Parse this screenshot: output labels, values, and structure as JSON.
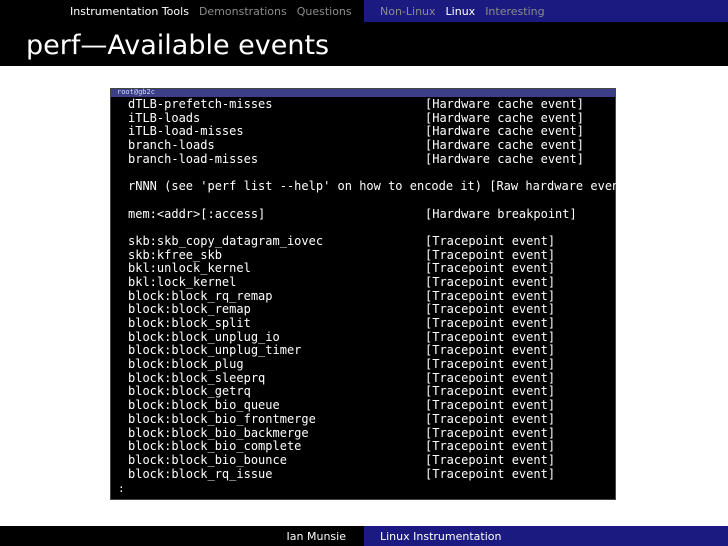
{
  "nav": {
    "sections": [
      "Instrumentation Tools",
      "Demonstrations",
      "Questions"
    ],
    "subsections": [
      "Non-Linux",
      "Linux",
      "Interesting"
    ],
    "active_section": "Instrumentation Tools",
    "active_subsection": "Linux"
  },
  "frame_title": "perf—Available events",
  "terminal": {
    "window_title": "root@gb2c",
    "rows": [
      {
        "event": "dTLB-prefetch-misses",
        "type": "[Hardware cache event]"
      },
      {
        "event": "iTLB-loads",
        "type": "[Hardware cache event]"
      },
      {
        "event": "iTLB-load-misses",
        "type": "[Hardware cache event]"
      },
      {
        "event": "branch-loads",
        "type": "[Hardware cache event]"
      },
      {
        "event": "branch-load-misses",
        "type": "[Hardware cache event]"
      },
      {
        "event": "",
        "type": ""
      },
      {
        "full": "rNNN (see 'perf list --help' on how to encode it) [Raw hardware event"
      },
      {
        "event": "",
        "type": ""
      },
      {
        "event": "mem:<addr>[:access]",
        "type": "[Hardware breakpoint]"
      },
      {
        "event": "",
        "type": ""
      },
      {
        "event": "skb:skb_copy_datagram_iovec",
        "type": "[Tracepoint event]"
      },
      {
        "event": "skb:kfree_skb",
        "type": "[Tracepoint event]"
      },
      {
        "event": "bkl:unlock_kernel",
        "type": "[Tracepoint event]"
      },
      {
        "event": "bkl:lock_kernel",
        "type": "[Tracepoint event]"
      },
      {
        "event": "block:block_rq_remap",
        "type": "[Tracepoint event]"
      },
      {
        "event": "block:block_remap",
        "type": "[Tracepoint event]"
      },
      {
        "event": "block:block_split",
        "type": "[Tracepoint event]"
      },
      {
        "event": "block:block_unplug_io",
        "type": "[Tracepoint event]"
      },
      {
        "event": "block:block_unplug_timer",
        "type": "[Tracepoint event]"
      },
      {
        "event": "block:block_plug",
        "type": "[Tracepoint event]"
      },
      {
        "event": "block:block_sleeprq",
        "type": "[Tracepoint event]"
      },
      {
        "event": "block:block_getrq",
        "type": "[Tracepoint event]"
      },
      {
        "event": "block:block_bio_queue",
        "type": "[Tracepoint event]"
      },
      {
        "event": "block:block_bio_frontmerge",
        "type": "[Tracepoint event]"
      },
      {
        "event": "block:block_bio_backmerge",
        "type": "[Tracepoint event]"
      },
      {
        "event": "block:block_bio_complete",
        "type": "[Tracepoint event]"
      },
      {
        "event": "block:block_bio_bounce",
        "type": "[Tracepoint event]"
      },
      {
        "event": "block:block_rq_issue",
        "type": "[Tracepoint event]"
      }
    ],
    "prompt": ":"
  },
  "footer": {
    "author": "Ian Munsie",
    "short_title": "Linux Instrumentation"
  },
  "colors": {
    "nav_left_bg": "#000000",
    "nav_right_bg": "#1a1a80",
    "active_text": "#ffffff",
    "inactive_text": "#8c8c8c",
    "terminal_bg": "#000000",
    "terminal_text": "#ffffff"
  }
}
